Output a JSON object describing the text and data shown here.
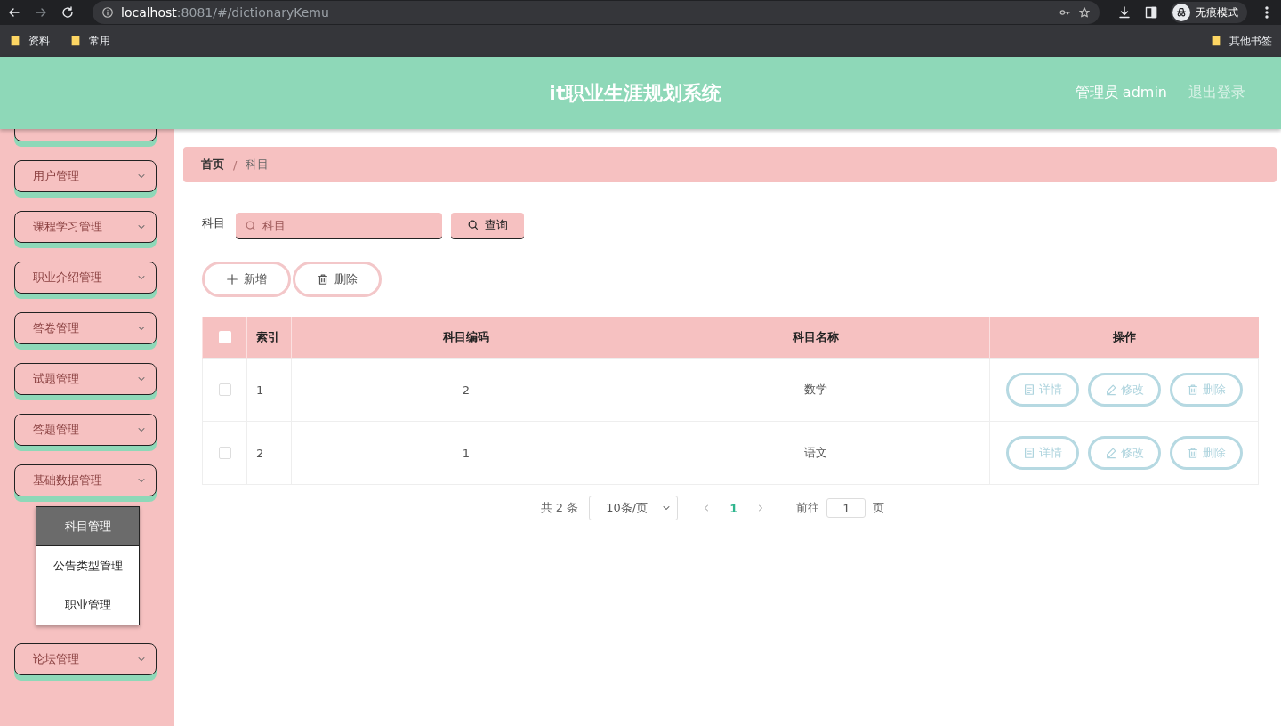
{
  "browser": {
    "url_host": "localhost",
    "url_path": ":8081/#/dictionaryKemu",
    "profile_label": "无痕模式",
    "bookmarks": [
      "资料",
      "常用"
    ],
    "other_bookmarks": "其他书签"
  },
  "header": {
    "title": "it职业生涯规划系统",
    "user": "管理员 admin",
    "logout": "退出登录"
  },
  "sidebar": {
    "items": [
      {
        "label": "用户管理"
      },
      {
        "label": "课程学习管理"
      },
      {
        "label": "职业介绍管理"
      },
      {
        "label": "答卷管理"
      },
      {
        "label": "试题管理"
      },
      {
        "label": "答题管理"
      },
      {
        "label": "基础数据管理",
        "children": [
          {
            "label": "科目管理",
            "selected": true
          },
          {
            "label": "公告类型管理",
            "selected": false
          },
          {
            "label": "职业管理",
            "selected": false
          }
        ]
      },
      {
        "label": "论坛管理"
      }
    ]
  },
  "breadcrumb": [
    "首页",
    "科目"
  ],
  "breadcrumb_separator": "/",
  "search": {
    "label": "科目",
    "placeholder": "科目",
    "button": "查询"
  },
  "actions": [
    {
      "label": "新增",
      "kind": "add"
    },
    {
      "label": "删除",
      "kind": "delete"
    }
  ],
  "table": {
    "all_checked": false,
    "columns": [
      "索引",
      "科目编码",
      "科目名称",
      "操作"
    ],
    "rows": [
      {
        "checked": false,
        "cells": [
          "1",
          "2",
          "数学"
        ],
        "actions": [
          {
            "label": "详情",
            "kind": "detail"
          },
          {
            "label": "修改",
            "kind": "edit"
          },
          {
            "label": "删除",
            "kind": "delete"
          }
        ]
      },
      {
        "checked": false,
        "cells": [
          "2",
          "1",
          "语文"
        ],
        "actions": [
          {
            "label": "详情",
            "kind": "detail"
          },
          {
            "label": "修改",
            "kind": "edit"
          },
          {
            "label": "删除",
            "kind": "delete"
          }
        ]
      }
    ]
  },
  "pagination": {
    "total": "共 2 条",
    "page_size": "10条/页",
    "pages": [
      {
        "label": "1",
        "selected": true
      }
    ],
    "goto_label": "前往",
    "goto_value": "1",
    "page_suffix": "页"
  }
}
